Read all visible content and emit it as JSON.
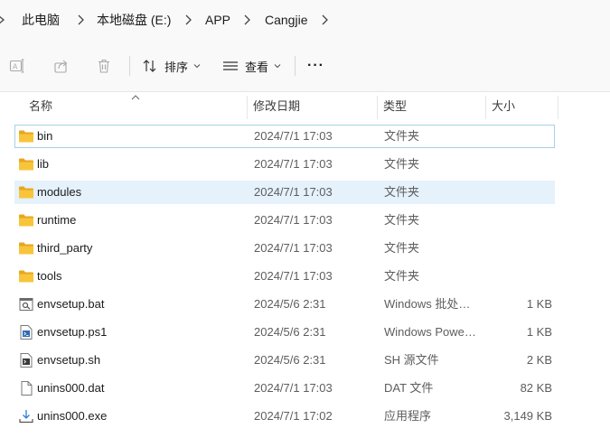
{
  "breadcrumb": [
    "此电脑",
    "本地磁盘 (E:)",
    "APP",
    "Cangjie"
  ],
  "toolbar": {
    "sort_label": "排序",
    "view_label": "查看",
    "more_label": "···"
  },
  "columns": {
    "name": "名称",
    "date": "修改日期",
    "type": "类型",
    "size": "大小"
  },
  "files": [
    {
      "name": "bin",
      "date": "2024/7/1 17:03",
      "type": "文件夹",
      "size": "",
      "icon": "folder-icon"
    },
    {
      "name": "lib",
      "date": "2024/7/1 17:03",
      "type": "文件夹",
      "size": "",
      "icon": "folder-icon"
    },
    {
      "name": "modules",
      "date": "2024/7/1 17:03",
      "type": "文件夹",
      "size": "",
      "icon": "folder-icon"
    },
    {
      "name": "runtime",
      "date": "2024/7/1 17:03",
      "type": "文件夹",
      "size": "",
      "icon": "folder-icon"
    },
    {
      "name": "third_party",
      "date": "2024/7/1 17:03",
      "type": "文件夹",
      "size": "",
      "icon": "folder-icon"
    },
    {
      "name": "tools",
      "date": "2024/7/1 17:03",
      "type": "文件夹",
      "size": "",
      "icon": "folder-icon"
    },
    {
      "name": "envsetup.bat",
      "date": "2024/5/6 2:31",
      "type": "Windows 批处理文件",
      "size": "1 KB",
      "icon": "batch-file-icon"
    },
    {
      "name": "envsetup.ps1",
      "date": "2024/5/6 2:31",
      "type": "Windows PowerShell 脚本",
      "size": "1 KB",
      "icon": "powershell-file-icon"
    },
    {
      "name": "envsetup.sh",
      "date": "2024/5/6 2:31",
      "type": "SH 源文件",
      "size": "2 KB",
      "icon": "shell-file-icon"
    },
    {
      "name": "unins000.dat",
      "date": "2024/7/1 17:03",
      "type": "DAT 文件",
      "size": "82 KB",
      "icon": "dat-file-icon"
    },
    {
      "name": "unins000.exe",
      "date": "2024/7/1 17:02",
      "type": "应用程序",
      "size": "3,149 KB",
      "icon": "installer-exe-icon"
    }
  ],
  "colors": {
    "folder": "#f8c53a",
    "folder_back": "#e8a620",
    "hover_row": "#e5f1fb",
    "focus_border": "#a6d1ea"
  }
}
